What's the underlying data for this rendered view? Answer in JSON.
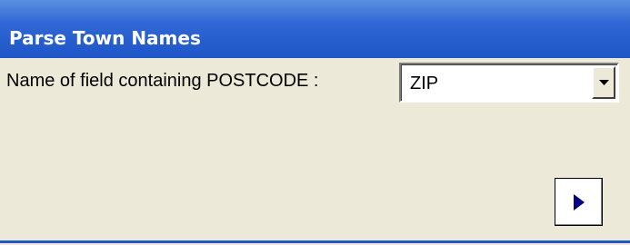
{
  "window": {
    "title": "Parse Town Names"
  },
  "form": {
    "postcode_field_label": "Name of field containing POSTCODE :",
    "postcode_field_value": "ZIP"
  },
  "icons": {
    "dropdown": "chevron-down-icon",
    "next": "play-right-icon"
  },
  "colors": {
    "titlebar": "#2f67d4",
    "background": "#ece9d8",
    "arrow": "#000080"
  }
}
